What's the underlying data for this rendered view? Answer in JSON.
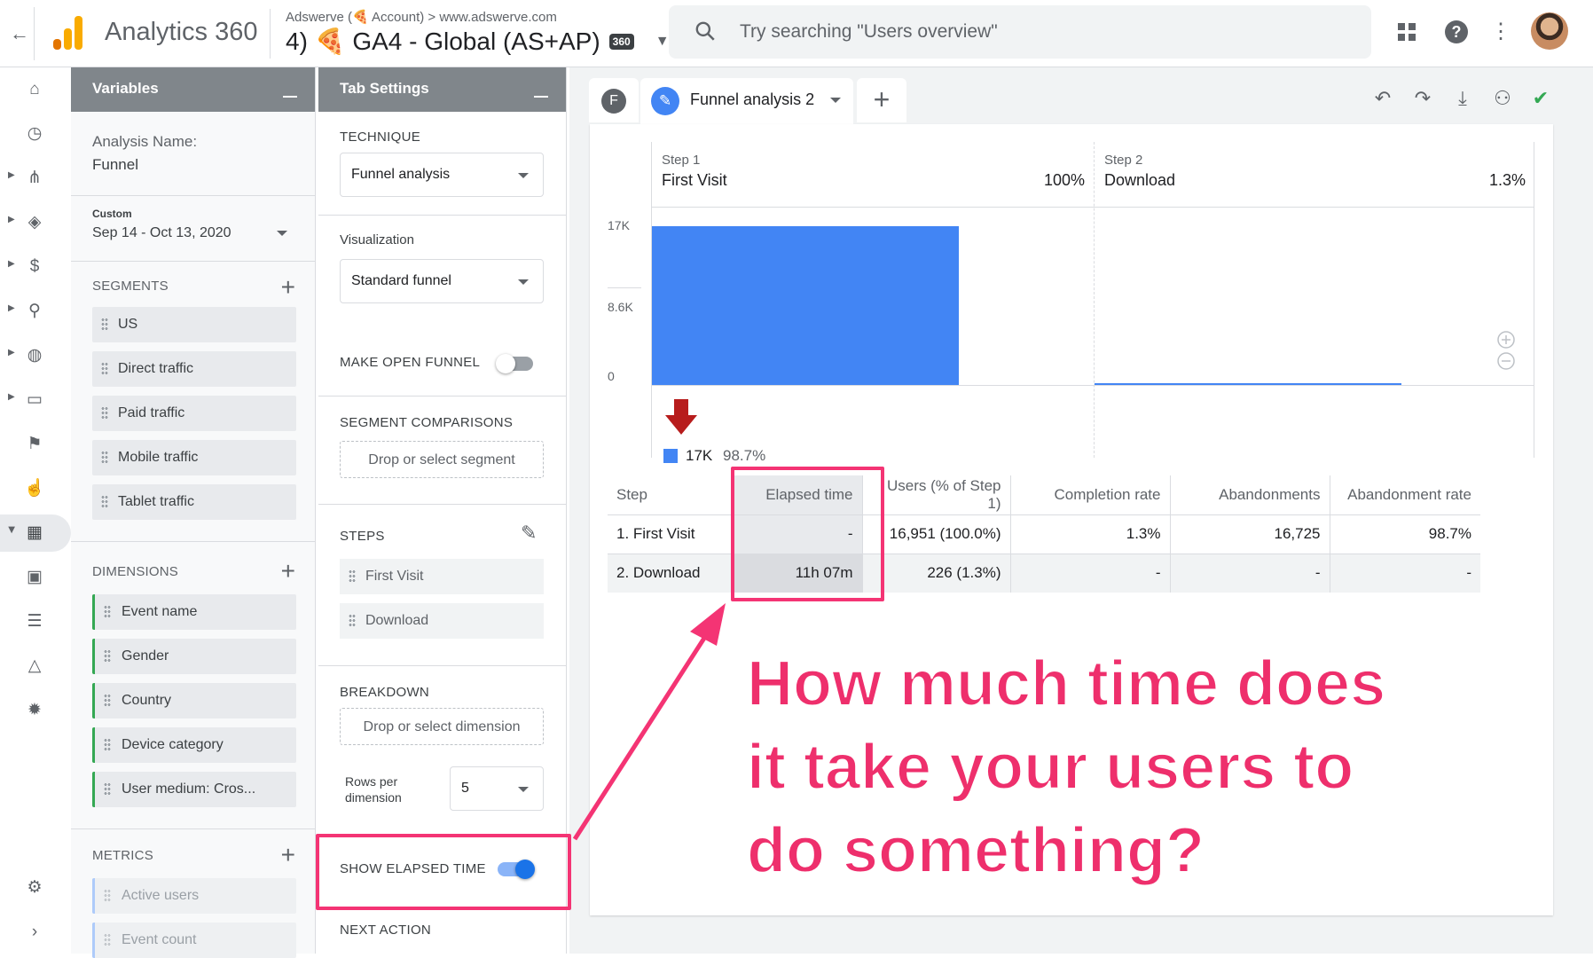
{
  "topbar": {
    "brand": "Analytics 360",
    "account_line": "Adswerve (🍕 Account) > www.adswerve.com",
    "property_name": "4) 🍕 GA4 - Global (AS+AP)",
    "property_badge": "360",
    "search_placeholder": "Try searching \"Users overview\""
  },
  "variables_panel": {
    "title": "Variables",
    "analysis_name_label": "Analysis Name:",
    "analysis_name_value": "Funnel",
    "date_label": "Custom",
    "date_range": "Sep 14 - Oct 13, 2020",
    "segments_title": "SEGMENTS",
    "segments": [
      "US",
      "Direct traffic",
      "Paid traffic",
      "Mobile traffic",
      "Tablet traffic"
    ],
    "dimensions_title": "DIMENSIONS",
    "dimensions": [
      "Event name",
      "Gender",
      "Country",
      "Device category",
      "User medium: Cros..."
    ],
    "metrics_title": "METRICS",
    "metrics": [
      "Active users",
      "Event count"
    ]
  },
  "tab_settings": {
    "title": "Tab Settings",
    "technique_label": "TECHNIQUE",
    "technique_value": "Funnel analysis",
    "visualization_label": "Visualization",
    "visualization_value": "Standard funnel",
    "open_funnel_label": "MAKE OPEN FUNNEL",
    "open_funnel_on": false,
    "segment_comparisons_label": "SEGMENT COMPARISONS",
    "segment_drop_text": "Drop or select segment",
    "steps_label": "STEPS",
    "steps": [
      "First Visit",
      "Download"
    ],
    "breakdown_label": "BREAKDOWN",
    "dimension_drop_text": "Drop or select dimension",
    "rows_per_dimension_label_1": "Rows per",
    "rows_per_dimension_label_2": "dimension",
    "rows_per_dimension_value": "5",
    "elapsed_time_label": "SHOW ELAPSED TIME",
    "elapsed_time_on": true,
    "next_action_label": "NEXT ACTION"
  },
  "tabs": {
    "first_tab_letter": "F",
    "active_tab_name": "Funnel analysis 2"
  },
  "funnel_chart": {
    "steps": [
      {
        "number": "Step 1",
        "name": "First Visit",
        "percent": "100%"
      },
      {
        "number": "Step 2",
        "name": "Download",
        "percent": "1.3%"
      }
    ],
    "y_ticks": [
      "17K",
      "8.6K",
      "0"
    ],
    "dropoff_value": "17K",
    "dropoff_percent": "98.7%",
    "bar_color": "#4285f4",
    "dropoff_arrow_color": "#b71c1c"
  },
  "chart_data": {
    "type": "bar",
    "categories": [
      "First Visit",
      "Download"
    ],
    "values": [
      16951,
      226
    ],
    "ylim": [
      0,
      17000
    ],
    "ytick_labels": [
      "0",
      "8.6K",
      "17K"
    ]
  },
  "funnel_table": {
    "headers": [
      "Step",
      "Elapsed time",
      "Users (% of Step 1)",
      "Completion rate",
      "Abandonments",
      "Abandonment rate"
    ],
    "rows": [
      [
        "1. First Visit",
        "-",
        "16,951 (100.0%)",
        "1.3%",
        "16,725",
        "98.7%"
      ],
      [
        "2. Download",
        "11h 07m",
        "226 (1.3%)",
        "-",
        "-",
        "-"
      ]
    ]
  },
  "annotation": {
    "callout_line1": "How much time does",
    "callout_line2": "it take your users to",
    "callout_line3": "do something?",
    "highlight_color": "#f43474"
  }
}
